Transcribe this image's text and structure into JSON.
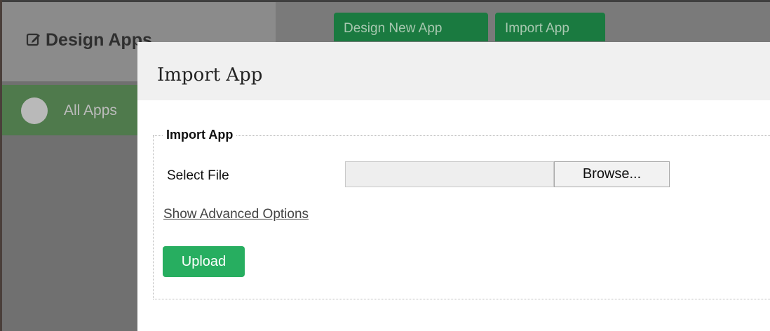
{
  "background": {
    "app_title": "Design Apps",
    "title_icon": "edit-icon",
    "nav": {
      "item_label": "All Apps"
    },
    "toolbar": {
      "design_new_label": "Design New App",
      "import_label": "Import App"
    }
  },
  "modal": {
    "title": "Import App",
    "fieldset_legend": "Import App",
    "select_file_label": "Select File",
    "browse_label": "Browse...",
    "advanced_link": "Show Advanced Options",
    "upload_label": "Upload"
  },
  "colors": {
    "upload_button": "#27ae60",
    "overlay": "#707070"
  }
}
